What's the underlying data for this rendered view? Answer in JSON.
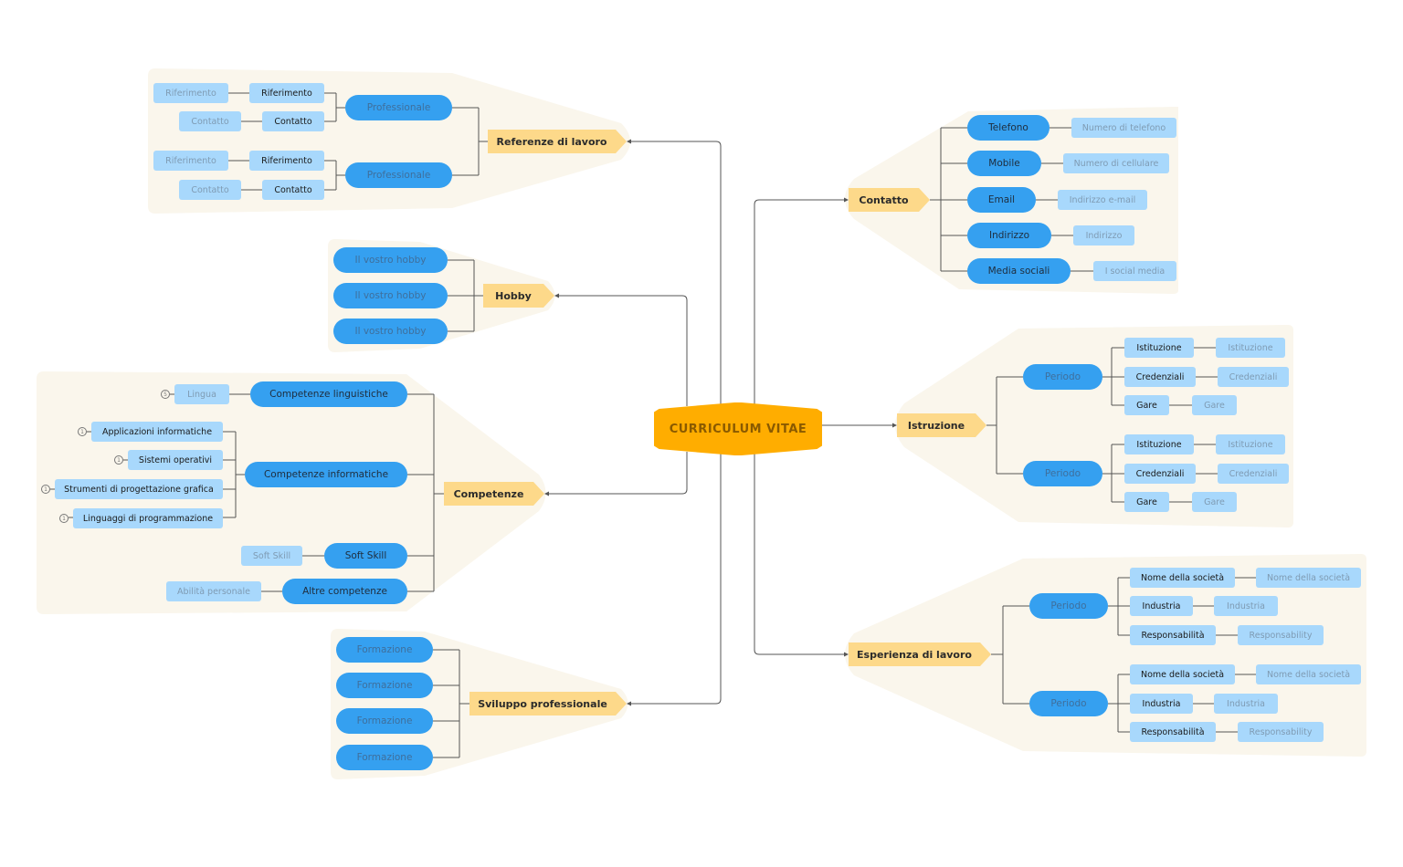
{
  "central": {
    "label": "CURRICULUM VITAE"
  },
  "colors": {
    "central": "#ffad00",
    "topic": "#fdd98a",
    "pill": "#35a0f0",
    "box": "#a8d8fc",
    "group_background": "#faf6ec",
    "connector": "#555555"
  },
  "referenze": {
    "label": "Referenze di lavoro",
    "groups": [
      {
        "label": "Professionale",
        "items": [
          {
            "key": "Riferimento",
            "value": "Riferimento"
          },
          {
            "key": "Contatto",
            "value": "Contatto"
          }
        ]
      },
      {
        "label": "Professionale",
        "items": [
          {
            "key": "Riferimento",
            "value": "Riferimento"
          },
          {
            "key": "Contatto",
            "value": "Contatto"
          }
        ]
      }
    ]
  },
  "hobby": {
    "label": "Hobby",
    "items": [
      "Il vostro hobby",
      "Il vostro hobby",
      "Il vostro hobby"
    ]
  },
  "competenze": {
    "label": "Competenze",
    "linguistiche": {
      "label": "Competenze linguistiche",
      "child": "Lingua",
      "badge": "5"
    },
    "informatiche": {
      "label": "Competenze informatiche",
      "children": [
        {
          "label": "Applicazioni informatiche",
          "badge": "1"
        },
        {
          "label": "Sistemi operativi",
          "badge": "1"
        },
        {
          "label": "Strumenti di progettazione grafica",
          "badge": "1"
        },
        {
          "label": "Linguaggi di programmazione",
          "badge": "1"
        }
      ]
    },
    "soft": {
      "label": "Soft Skill",
      "child": "Soft Skill"
    },
    "altre": {
      "label": "Altre competenze",
      "child": "Abilità personale"
    }
  },
  "sviluppo": {
    "label": "Sviluppo professionale",
    "items": [
      "Formazione",
      "Formazione",
      "Formazione",
      "Formazione"
    ]
  },
  "contatto": {
    "label": "Contatto",
    "items": [
      {
        "key": "Telefono",
        "value": "Numero di telefono"
      },
      {
        "key": "Mobile",
        "value": "Numero di cellulare"
      },
      {
        "key": "Email",
        "value": "Indirizzo e-mail"
      },
      {
        "key": "Indirizzo",
        "value": "Indirizzo"
      },
      {
        "key": "Media sociali",
        "value": "I social media"
      }
    ]
  },
  "istruzione": {
    "label": "Istruzione",
    "groups": [
      {
        "label": "Periodo",
        "items": [
          {
            "key": "Istituzione",
            "value": "Istituzione"
          },
          {
            "key": "Credenziali",
            "value": "Credenziali"
          },
          {
            "key": "Gare",
            "value": "Gare"
          }
        ]
      },
      {
        "label": "Periodo",
        "items": [
          {
            "key": "Istituzione",
            "value": "Istituzione"
          },
          {
            "key": "Credenziali",
            "value": "Credenziali"
          },
          {
            "key": "Gare",
            "value": "Gare"
          }
        ]
      }
    ]
  },
  "esperienza": {
    "label": "Esperienza di lavoro",
    "groups": [
      {
        "label": "Periodo",
        "items": [
          {
            "key": "Nome della società",
            "value": "Nome della società"
          },
          {
            "key": "Industria",
            "value": "Industria"
          },
          {
            "key": "Responsabilità",
            "value": "Responsability"
          }
        ]
      },
      {
        "label": "Periodo",
        "items": [
          {
            "key": "Nome della società",
            "value": "Nome della società"
          },
          {
            "key": "Industria",
            "value": "Industria"
          },
          {
            "key": "Responsabilità",
            "value": "Responsability"
          }
        ]
      }
    ]
  }
}
